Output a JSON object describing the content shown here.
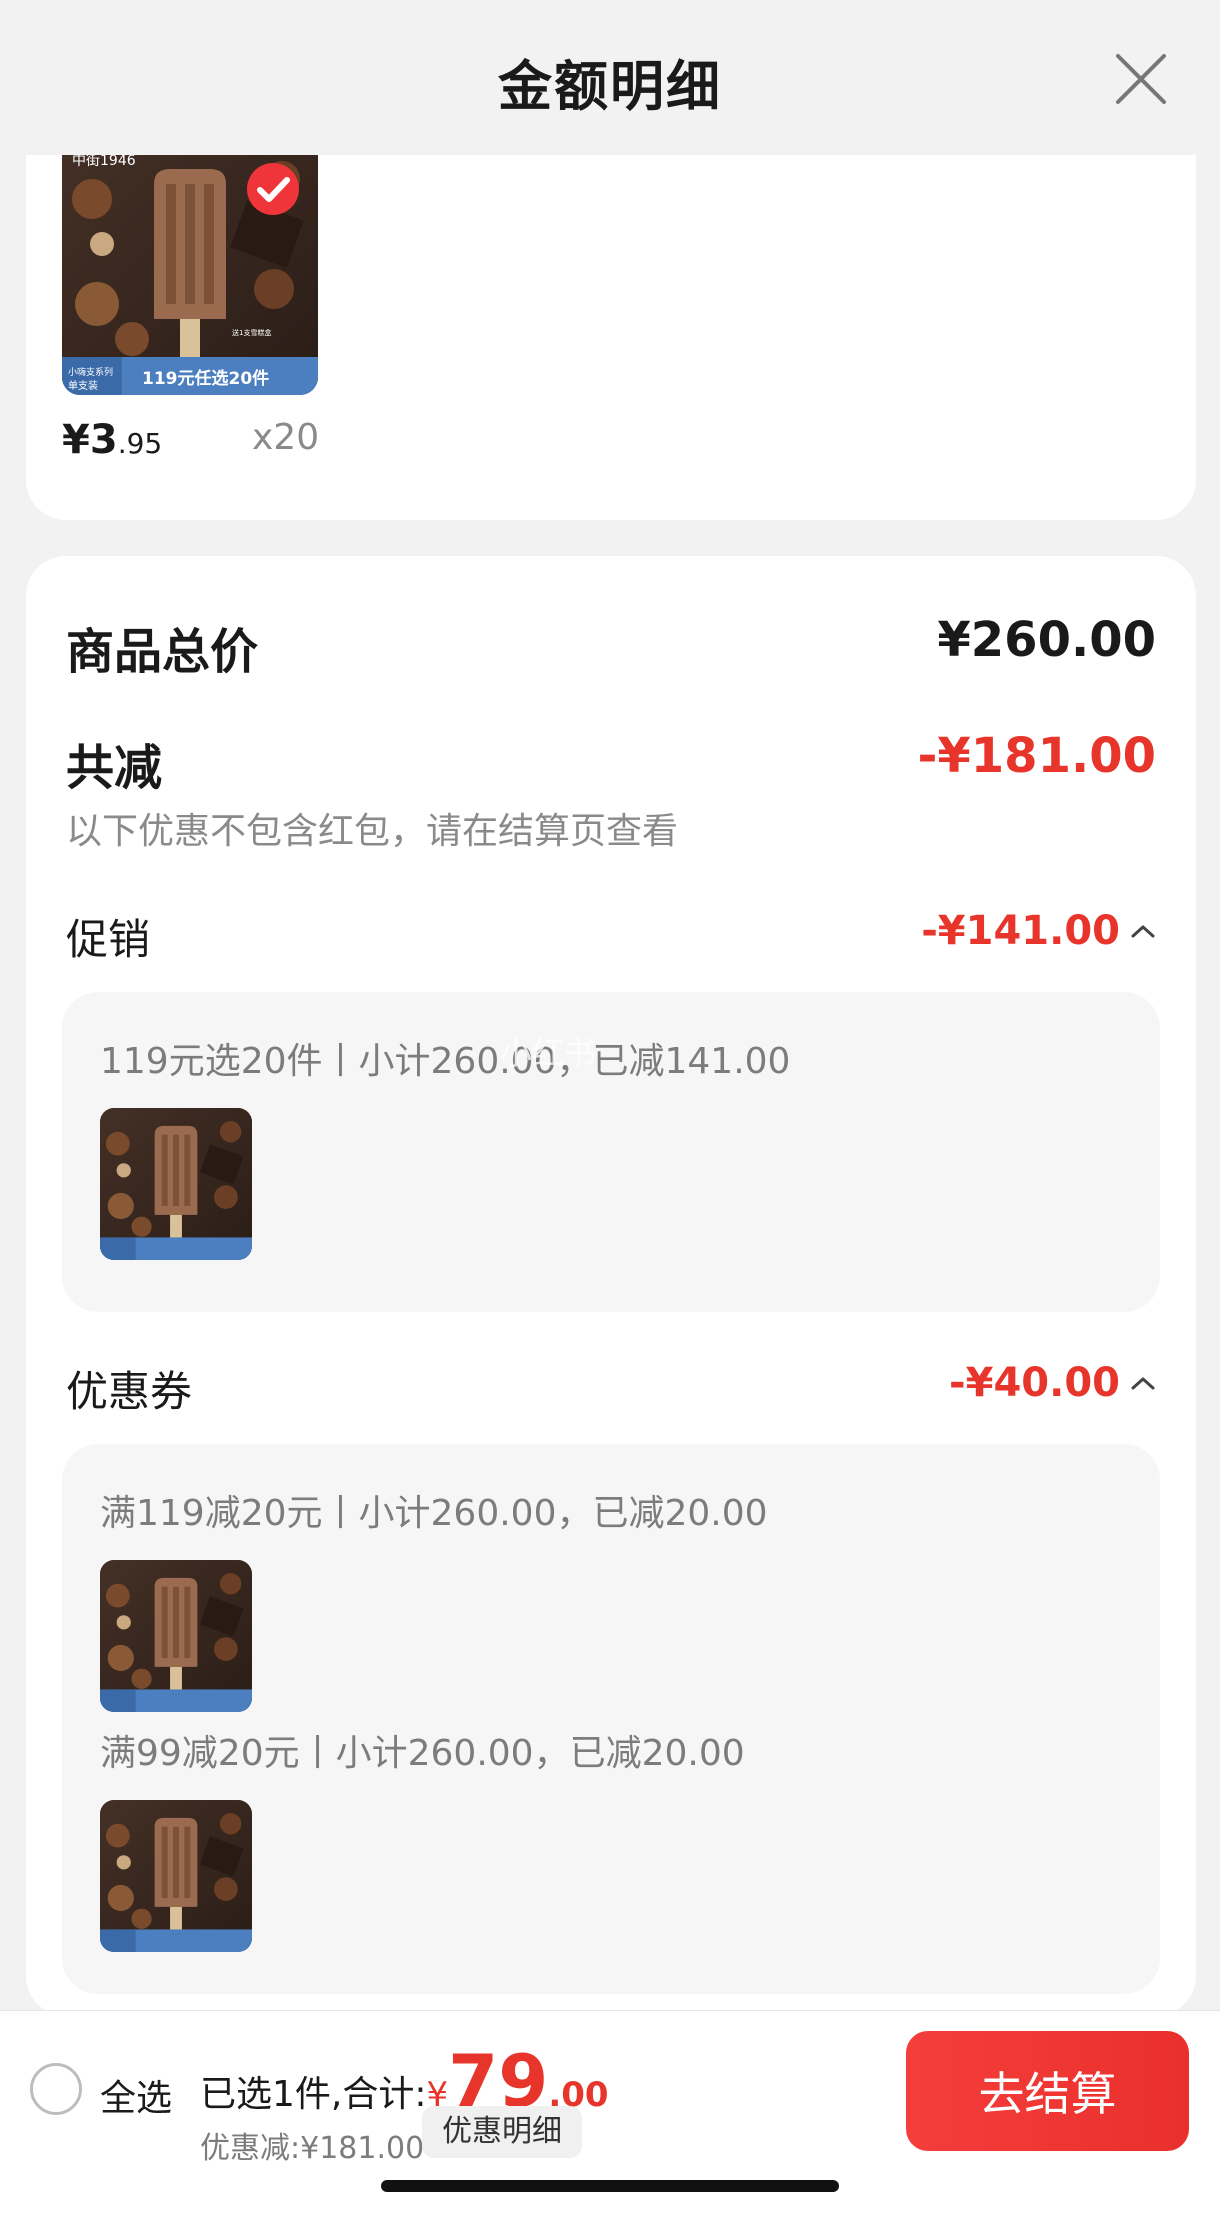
{
  "header": {
    "title": "金额明细"
  },
  "product": {
    "price_symbol": "¥",
    "price_int": "3",
    "price_dec": ".95",
    "quantity": "x20",
    "image": {
      "brand_text": "中街1946",
      "tag_small_1": "小嗨支系列",
      "tag_small_2": "单支装",
      "promo_text": "119元任选20件",
      "side_note": "送1支雪糕盒",
      "colors": {
        "bg": "#3b2a22",
        "bar": "#9b6b50",
        "banner": "#4c7fc0"
      }
    }
  },
  "summary": {
    "total_label": "商品总价",
    "total_value": "¥260.00",
    "reduce_label": "共减",
    "reduce_value": "-¥181.00",
    "reduce_note": "以下优惠不包含红包，请在结算页查看"
  },
  "promotion": {
    "label": "促销",
    "value": "-¥141.00",
    "line": "119元选20件丨小计260.00，已减141.00"
  },
  "coupon": {
    "label": "优惠券",
    "value": "-¥40.00",
    "lines": [
      "满119减20元丨小计260.00，已减20.00",
      "满99减20元丨小计260.00，已减20.00"
    ]
  },
  "bottom": {
    "select_all": "全选",
    "selected_text": "已选1件,合计:",
    "currency": "¥",
    "total_int": "79",
    "total_dec": ".00",
    "discount_text": "优惠减:¥181.00",
    "detail_chip": "优惠明细",
    "checkout": "去结算"
  },
  "watermark": "小红书",
  "colors": {
    "accent": "#e8352b",
    "checkout": "#f43e3b"
  }
}
